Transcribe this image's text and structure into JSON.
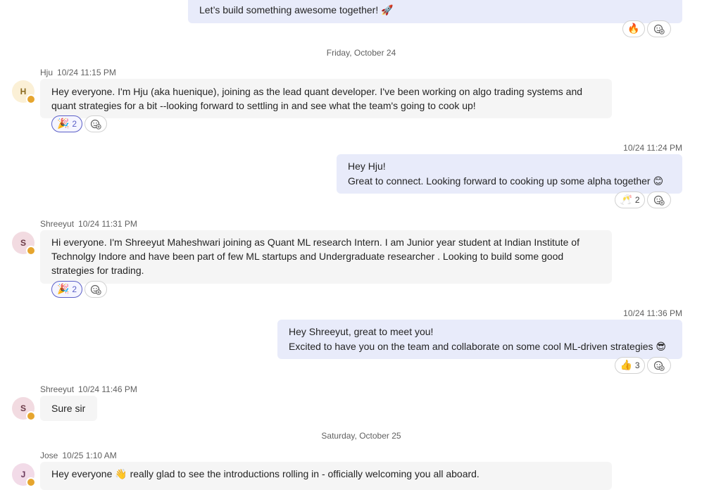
{
  "messages": {
    "m0": {
      "lines": [
        "Let’s build something awesome together! 🚀"
      ],
      "reactions": {
        "r1": {
          "emoji": "🔥"
        }
      }
    },
    "sep1": "Friday, October 24",
    "m1": {
      "author": "Hju",
      "time": "10/24 11:15 PM",
      "initial": "H",
      "lines": [
        "Hey everyone. I'm Hju (aka huenique), joining as the lead quant developer. I've been working on algo trading systems and",
        "quant strategies for a bit --looking forward to settling in and see what the team's going to cook up!"
      ],
      "reactions": {
        "r1": {
          "emoji": "🎉",
          "count": "2"
        }
      }
    },
    "m2": {
      "time": "10/24 11:24 PM",
      "lines": [
        "Hey Hju!",
        "Great to connect. Looking forward to cooking up some alpha together 😊"
      ],
      "reactions": {
        "r1": {
          "emoji": "🥂",
          "count": "2"
        }
      }
    },
    "m3": {
      "author": "Shreeyut",
      "time": "10/24 11:31 PM",
      "initial": "S",
      "lines": [
        "Hi everyone. I'm Shreeyut Maheshwari joining as Quant ML research Intern. I am Junior year student at Indian Institute of",
        "Technolgy Indore and have been part of few ML startups and Undergraduate researcher . Looking to build some good",
        "strategies for trading."
      ],
      "reactions": {
        "r1": {
          "emoji": "🎉",
          "count": "2"
        }
      }
    },
    "m4": {
      "time": "10/24 11:36 PM",
      "lines": [
        "Hey Shreeyut, great to meet you!",
        "Excited to have you on the team and collaborate on some cool ML-driven strategies 😎"
      ],
      "reactions": {
        "r1": {
          "emoji": "👍",
          "count": "3"
        }
      }
    },
    "m5": {
      "author": "Shreeyut",
      "time": "10/24 11:46 PM",
      "initial": "S",
      "lines": [
        "Sure sir"
      ]
    },
    "sep2": "Saturday, October 25",
    "m6": {
      "author": "Jose",
      "time": "10/25 1:10 AM",
      "initial": "J",
      "lines": [
        "Hey everyone 👋 really glad to see the introductions rolling in - officially welcoming you all aboard."
      ]
    }
  },
  "icons": {
    "add_reaction": "add-reaction-icon",
    "status": "away-status-icon"
  },
  "colors": {
    "self_bubble": "#e8ebfa",
    "other_bubble": "#f5f5f5",
    "accent": "#5b5fc7",
    "avatar_h_bg": "#fbf0d6",
    "avatar_s_bg": "#f2dbe1",
    "avatar_j_bg": "#f2dbe8",
    "status": "#e6a52e"
  }
}
